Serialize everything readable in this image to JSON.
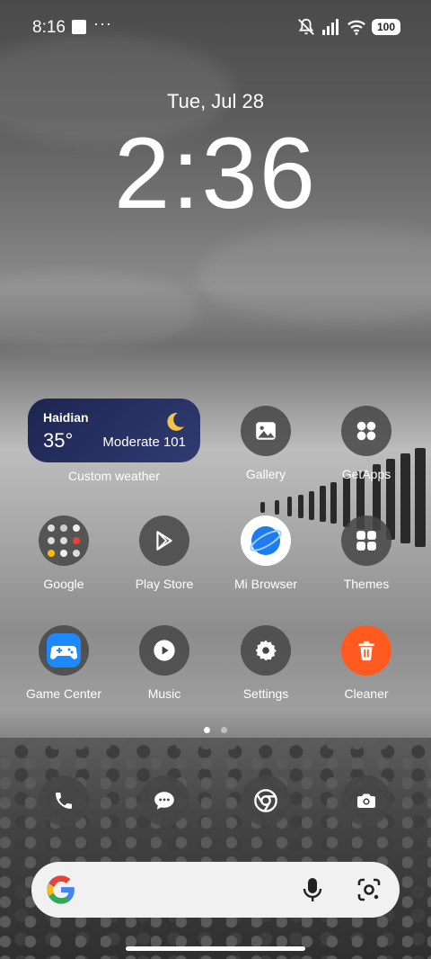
{
  "status_bar": {
    "time": "8:16",
    "dots": "···",
    "battery": "100"
  },
  "lock": {
    "date": "Tue, Jul 28",
    "time": "2:36"
  },
  "weather": {
    "city": "Haidian",
    "temp": "35°",
    "aqi": "Moderate 101",
    "label": "Custom weather"
  },
  "apps": {
    "gallery": "Gallery",
    "getapps": "GetApps",
    "google": "Google",
    "play_store": "Play Store",
    "mi_browser": "Mi Browser",
    "themes": "Themes",
    "game_center": "Game Center",
    "music": "Music",
    "settings": "Settings",
    "cleaner": "Cleaner"
  },
  "dock": [
    "phone-icon",
    "messages-icon",
    "chrome-icon",
    "camera-icon"
  ],
  "search_bar": {
    "icons": [
      "google-g-icon",
      "microphone-icon",
      "google-lens-icon"
    ]
  },
  "page_indicator": {
    "pages": 2,
    "current": 1
  },
  "colors": {
    "weather_bg": "#1d2550",
    "cleaner": "#ff5a1f",
    "browser": "#1e7bf0",
    "game_center": "#1e88ff"
  }
}
